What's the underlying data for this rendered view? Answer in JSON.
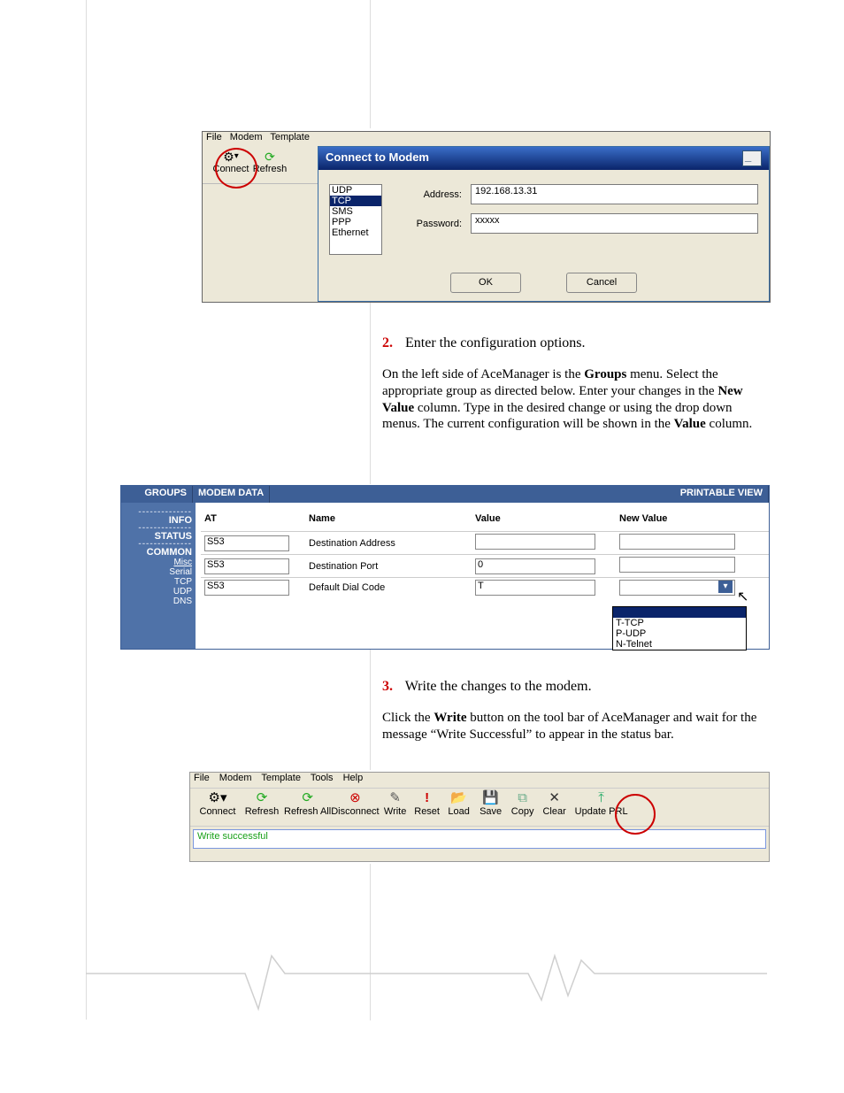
{
  "screenshot1": {
    "menus": {
      "file": "File",
      "modem": "Modem",
      "template": "Template"
    },
    "tools": {
      "connect": "Connect",
      "refresh": "Refresh"
    },
    "dialog": {
      "title": "Connect to Modem",
      "list": {
        "udp": "UDP",
        "tcp": "TCP",
        "sms": "SMS",
        "ppp": "PPP",
        "eth": "Ethernet"
      },
      "address_label": "Address:",
      "address_value": "192.168.13.31",
      "password_label": "Password:",
      "password_value": "xxxxx",
      "ok": "OK",
      "cancel": "Cancel"
    }
  },
  "text": {
    "step2_num": "2.",
    "step2_head": "Enter the configuration options.",
    "step2_body_pre": "On the left side of AceManager is the ",
    "step2_body_groups": "Groups",
    "step2_body_mid": " menu.  Select the appropriate group as directed below.  Enter your changes in the ",
    "step2_body_newvalue": "New Value",
    "step2_body_mid2": " column. Type in the desired change or using the drop down menus.  The current configuration will be shown in the ",
    "step2_body_value": "Value",
    "step2_body_end": " column.",
    "step3_num": "3.",
    "step3_head": "Write the changes to the modem.",
    "step3_body_pre": "Click the ",
    "step3_body_write": "Write",
    "step3_body_end": " button on the tool bar of AceManager and wait for the message “Write Successful” to appear in the status bar."
  },
  "screenshot2": {
    "tabs": {
      "groups": "GROUPS",
      "modem": "MODEM DATA",
      "print": "PRINTABLE VIEW"
    },
    "sidebar": {
      "info": "INFO",
      "status": "STATUS",
      "common": "COMMON",
      "misc": "Misc",
      "serial": "Serial",
      "tcp": "TCP",
      "udp": "UDP",
      "dns": "DNS"
    },
    "headers": {
      "at": "AT",
      "name": "Name",
      "value": "Value",
      "newvalue": "New Value"
    },
    "rows": [
      {
        "at": "S53",
        "name": "Destination Address",
        "value": ""
      },
      {
        "at": "S53",
        "name": "Destination Port",
        "value": "0"
      },
      {
        "at": "S53",
        "name": "Default Dial Code",
        "value": "T"
      }
    ],
    "dropdown": {
      "t": "T-TCP",
      "p": "P-UDP",
      "n": "N-Telnet"
    }
  },
  "screenshot3": {
    "menus": {
      "file": "File",
      "modem": "Modem",
      "template": "Template",
      "tools": "Tools",
      "help": "Help"
    },
    "tools": {
      "connect": "Connect",
      "refresh": "Refresh",
      "refreshall": "Refresh All",
      "disconnect": "Disconnect",
      "write": "Write",
      "reset": "Reset",
      "load": "Load",
      "save": "Save",
      "copy": "Copy",
      "clear": "Clear",
      "updateprl": "Update PRL"
    },
    "status": "Write successful"
  }
}
